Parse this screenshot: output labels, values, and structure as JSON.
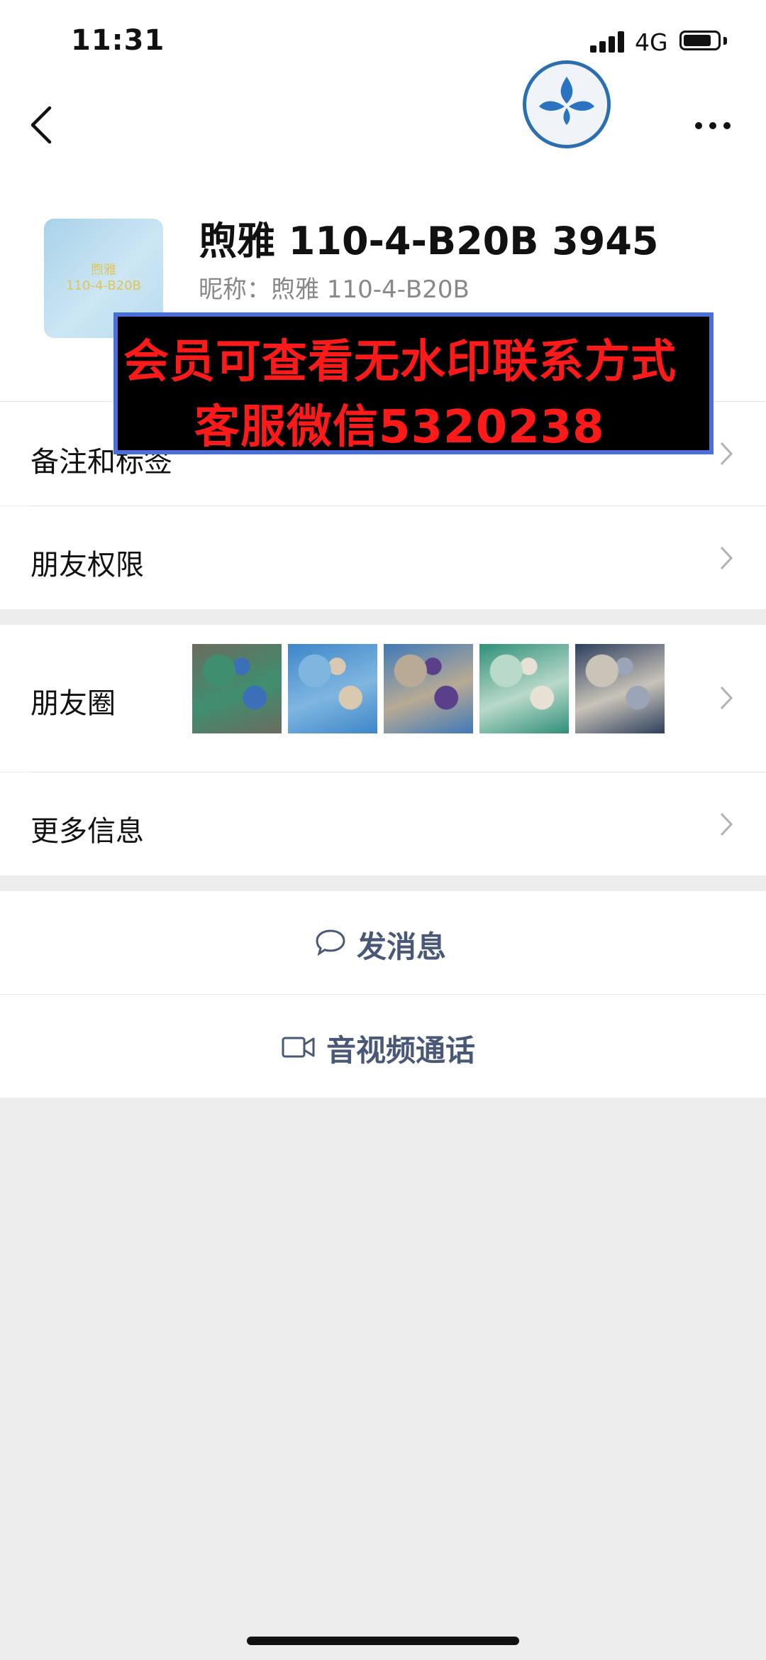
{
  "status_bar": {
    "time": "11:31",
    "network": "4G"
  },
  "nav": {
    "back_icon": "chevron-left-icon",
    "logo_icon": "water-drop-logo",
    "more_icon": "ellipsis-icon"
  },
  "profile": {
    "name": "煦雅 110-4-B20B 3945",
    "nickname": "昵称：煦雅 110-4-B20B",
    "avatar_text_line1": "煦雅",
    "avatar_text_line2": "110-4-B20B"
  },
  "watermark": {
    "line1": "会员可查看无水印联系方式",
    "line2": "客服微信5320238"
  },
  "rows": {
    "remark_label": "备注和标签",
    "permission_label": "朋友权限",
    "moments_label": "朋友圈",
    "more_info_label": "更多信息"
  },
  "moments_thumbnails": [
    {
      "subject": "shirts on hangers",
      "colors": [
        "#6b6b5e",
        "#3f8f6f",
        "#3b6fb7"
      ]
    },
    {
      "subject": "blue floral shirt",
      "colors": [
        "#3d86c9",
        "#7fb6e0",
        "#d8c9b0"
      ]
    },
    {
      "subject": "model in blue shirt",
      "colors": [
        "#3f79b8",
        "#b8aa95",
        "#5a3f8a"
      ]
    },
    {
      "subject": "green print shirt",
      "colors": [
        "#2f8f7a",
        "#b9d9c9",
        "#e7e1d4"
      ]
    },
    {
      "subject": "dark print shirt",
      "colors": [
        "#2d3f5e",
        "#c9c3b8",
        "#9aa6b7"
      ]
    }
  ],
  "actions": {
    "message_label": "发消息",
    "message_icon": "chat-bubble-icon",
    "call_label": "音视频通话",
    "call_icon": "video-camera-icon"
  },
  "colors": {
    "background": "#ededed",
    "action_text": "#4a5878",
    "watermark_text": "#ff1a1a",
    "watermark_border": "#4a6fd6"
  }
}
